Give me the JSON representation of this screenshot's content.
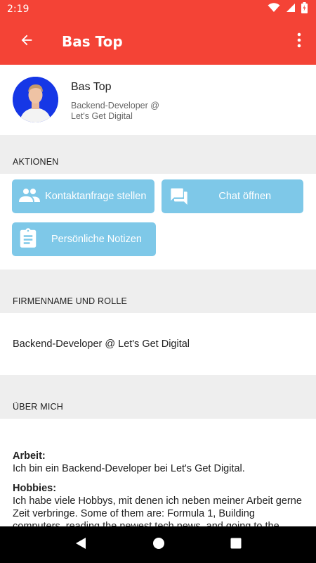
{
  "status": {
    "time": "2:19"
  },
  "app_bar": {
    "title": "Bas Top"
  },
  "profile": {
    "name": "Bas Top",
    "role": "Backend-Developer @ Let's Get Digital"
  },
  "sections": {
    "actions": "AKTIONEN",
    "company": "FIRMENNAME UND ROLLE",
    "about": "ÜBER MICH"
  },
  "actions": {
    "contact_request": "Kontaktanfrage stellen",
    "open_chat": "Chat öffnen",
    "personal_notes": "Persönliche Notizen"
  },
  "company_role": "Backend-Developer @ Let's Get Digital",
  "about": {
    "work_label": "Arbeit:",
    "work_text": "Ich bin ein Backend-Developer bei Let's Get Digital.",
    "hobbies_label": "Hobbies:",
    "hobbies_text": "Ich habe viele Hobbys, mit denen ich neben meiner Arbeit gerne Zeit verbringe. Some of them are: Formula 1, Building computers, reading the newest tech news, and going to the gym."
  },
  "colors": {
    "primary": "#f44336",
    "button": "#7ec8e8",
    "avatar_bg": "#1637e6",
    "section_bg": "#eeeeee"
  },
  "icons": [
    "wifi-icon",
    "signal-icon",
    "battery-icon",
    "back-arrow-icon",
    "more-vert-icon",
    "people-icon",
    "chat-icon",
    "clipboard-icon",
    "nav-back-icon",
    "nav-home-icon",
    "nav-recents-icon"
  ]
}
